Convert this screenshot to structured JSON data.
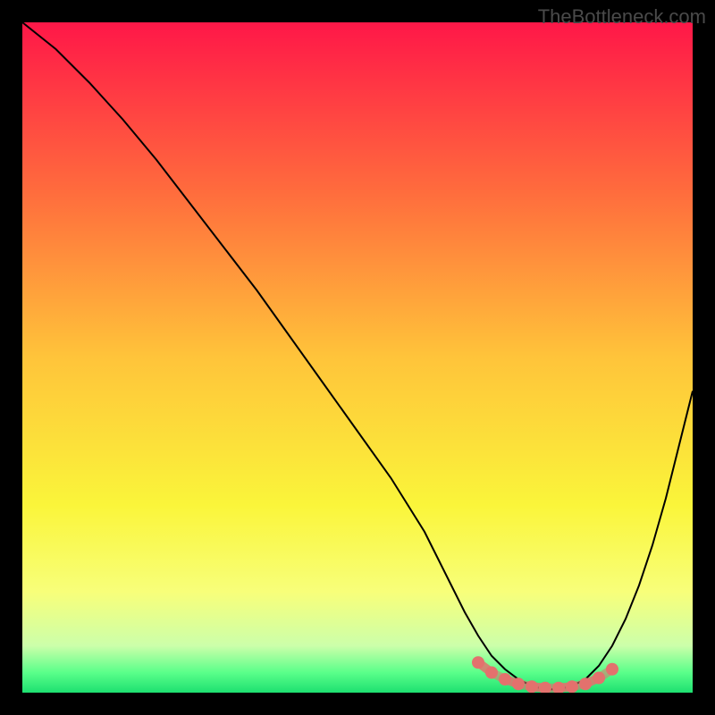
{
  "watermark": "TheBottleneck.com",
  "chart_data": {
    "type": "line",
    "title": "",
    "xlabel": "",
    "ylabel": "",
    "xlim": [
      0,
      100
    ],
    "ylim": [
      0,
      100
    ],
    "series": [
      {
        "name": "bottleneck-curve",
        "x": [
          0,
          5,
          10,
          15,
          20,
          25,
          30,
          35,
          40,
          45,
          50,
          55,
          60,
          62,
          64,
          66,
          68,
          70,
          72,
          74,
          76,
          78,
          80,
          82,
          84,
          86,
          88,
          90,
          92,
          94,
          96,
          98,
          100
        ],
        "values": [
          100,
          96,
          91,
          85.5,
          79.5,
          73,
          66.5,
          60,
          53,
          46,
          39,
          32,
          24,
          20,
          16,
          12,
          8.5,
          5.5,
          3.5,
          2,
          1,
          0.5,
          0.5,
          1,
          2,
          4,
          7,
          11,
          16,
          22,
          29,
          37,
          45
        ]
      }
    ],
    "markers": {
      "name": "optimal-range",
      "color": "#e3716d",
      "points": [
        {
          "x": 68,
          "y": 4.5
        },
        {
          "x": 70,
          "y": 3.0
        },
        {
          "x": 72,
          "y": 2.0
        },
        {
          "x": 74,
          "y": 1.3
        },
        {
          "x": 76,
          "y": 0.9
        },
        {
          "x": 78,
          "y": 0.7
        },
        {
          "x": 80,
          "y": 0.7
        },
        {
          "x": 82,
          "y": 0.9
        },
        {
          "x": 84,
          "y": 1.3
        },
        {
          "x": 86,
          "y": 2.2
        },
        {
          "x": 88,
          "y": 3.5
        }
      ]
    },
    "gradient_background": {
      "type": "vertical",
      "stops": [
        {
          "offset": 0,
          "color": "#ff1748"
        },
        {
          "offset": 0.25,
          "color": "#ff6b3d"
        },
        {
          "offset": 0.5,
          "color": "#ffc43a"
        },
        {
          "offset": 0.72,
          "color": "#faf53a"
        },
        {
          "offset": 0.85,
          "color": "#f8ff7a"
        },
        {
          "offset": 0.93,
          "color": "#ccffaa"
        },
        {
          "offset": 0.97,
          "color": "#5aff8a"
        },
        {
          "offset": 1.0,
          "color": "#1de070"
        }
      ]
    }
  }
}
